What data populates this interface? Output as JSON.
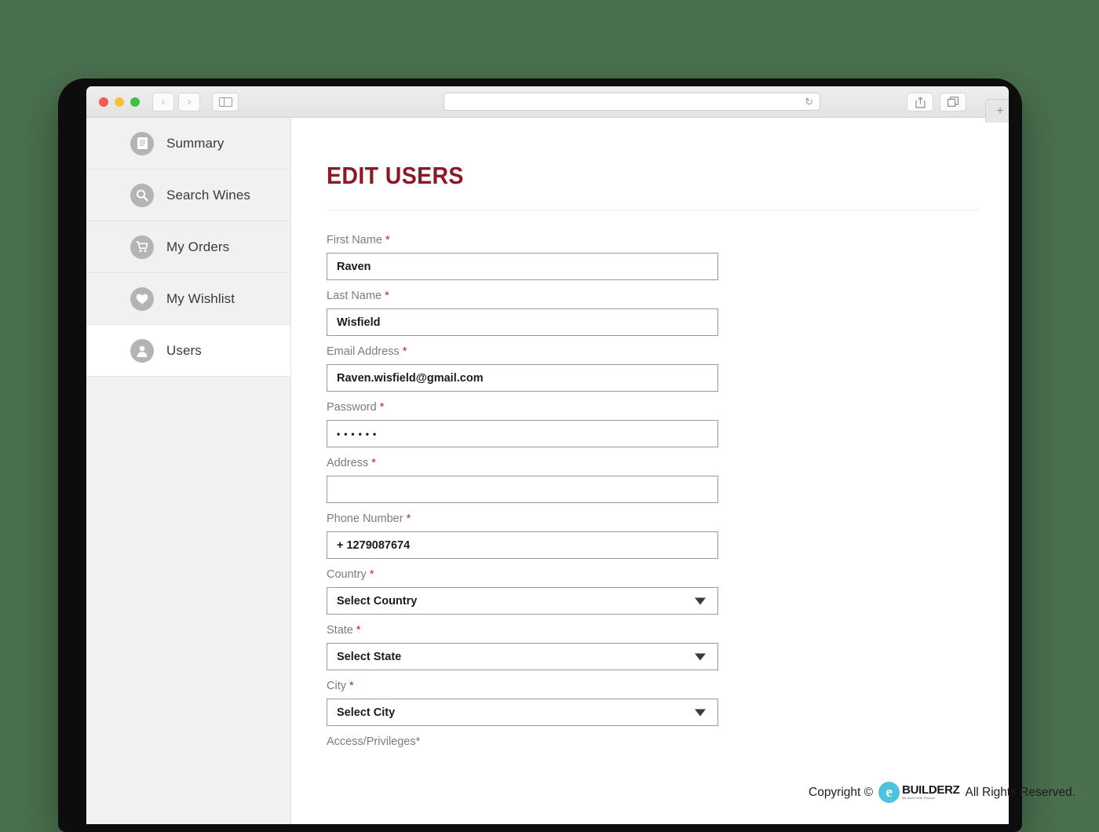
{
  "browser": {
    "traffic_lights": [
      "close",
      "minimize",
      "maximize"
    ],
    "back_label": "‹",
    "forward_label": "›",
    "sidebar_toggle_name": "sidebar-toggle",
    "address_value": "",
    "address_placeholder": "",
    "reload_label": "↻",
    "share_name": "share-icon",
    "tabs_name": "tab-overview-icon",
    "new_tab_label": "+"
  },
  "sidebar": {
    "items": [
      {
        "label": "Summary",
        "icon": "document-icon",
        "active": false
      },
      {
        "label": "Search Wines",
        "icon": "search-icon",
        "active": false
      },
      {
        "label": "My Orders",
        "icon": "cart-icon",
        "active": false
      },
      {
        "label": "My Wishlist",
        "icon": "heart-icon",
        "active": false
      },
      {
        "label": "Users",
        "icon": "user-icon",
        "active": true
      }
    ]
  },
  "main": {
    "title": "EDIT USERS",
    "accent_color": "#8b1a26",
    "required_marker": "*",
    "fields": [
      {
        "label": "First Name",
        "value": "Raven",
        "type": "text",
        "placeholder": ""
      },
      {
        "label": "Last Name",
        "value": "Wisfield",
        "type": "text",
        "placeholder": ""
      },
      {
        "label": "Email Address",
        "value": "Raven.wisfield@gmail.com",
        "type": "text",
        "placeholder": ""
      },
      {
        "label": "Password",
        "value": "••••••",
        "type": "password",
        "placeholder": ""
      },
      {
        "label": "Address",
        "value": "",
        "type": "text",
        "placeholder": ""
      },
      {
        "label": "Phone Number",
        "value": "+ 1279087674",
        "type": "text",
        "placeholder": ""
      },
      {
        "label": "Country",
        "value": "Select Country",
        "type": "select",
        "placeholder": ""
      },
      {
        "label": "State",
        "value": "Select State",
        "type": "select",
        "placeholder": ""
      },
      {
        "label": "City",
        "value": "Select City",
        "type": "select",
        "placeholder": ""
      }
    ],
    "cut_off_label": "Access/Privileges*"
  },
  "footer": {
    "copyright_prefix": "Copyright ©",
    "logo_mark": "e",
    "logo_name": "BUILDERZ",
    "logo_tagline": "We Build With Passion",
    "rights_text": "All Rights Reserved."
  }
}
